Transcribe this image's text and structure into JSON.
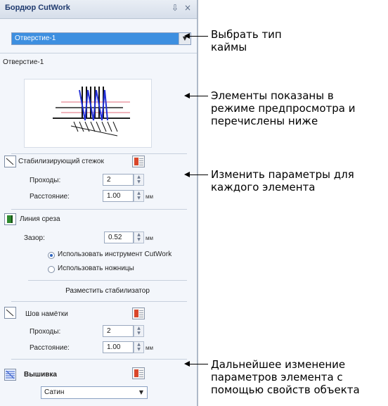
{
  "panel": {
    "title": "Бордюр CutWork",
    "pin_icon": "pin-icon",
    "close_icon": "close-icon",
    "type_select": {
      "value": "Отверстие-1"
    },
    "section_label": "Отверстие-1",
    "stabilizer": {
      "label": "Стабилизирующий стежок",
      "passes_label": "Проходы:",
      "passes_value": "2",
      "distance_label": "Расстояние:",
      "distance_value": "1.00",
      "unit": "мм"
    },
    "cut_line": {
      "label": "Линия среза",
      "gap_label": "Зазор:",
      "gap_value": "0.52",
      "unit": "мм",
      "radio_tool": "Использовать инструмент CutWork",
      "radio_scissors": "Использовать ножницы"
    },
    "place_stabilizer_button": "Разместить стабилизатор",
    "tackdown": {
      "label": "Шов намётки",
      "passes_label": "Проходы:",
      "passes_value": "2",
      "distance_label": "Расстояние:",
      "distance_value": "1.00",
      "unit": "мм"
    },
    "embroidery": {
      "label": "Вышивка",
      "select_value": "Сатин"
    }
  },
  "annotations": {
    "choose_type": [
      "Выбрать тип",
      "каймы"
    ],
    "preview": [
      "Элементы показаны в",
      "режиме предпросмотра и",
      "перечислены ниже"
    ],
    "change_params": [
      "Изменить параметры для",
      "каждого элемента"
    ],
    "further_change": [
      "Дальнейшее изменение",
      "параметров элемента с",
      "помощью свойств объекта"
    ]
  }
}
